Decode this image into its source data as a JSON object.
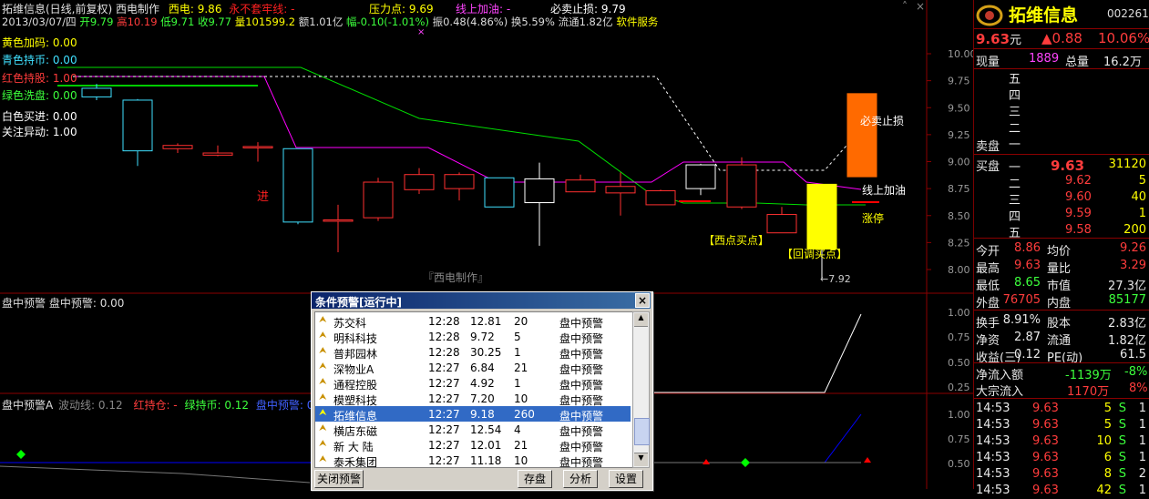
{
  "header": {
    "stock_title": "拓维信息(日线,前复权)",
    "indicator": "西电制作",
    "xidian_label": "西电:",
    "xidian_value": "9.86",
    "never_cover_label": "永不套牢线:",
    "never_cover_value": "-",
    "pressure_label": "压力点:",
    "pressure_value": "9.69",
    "online_add_label": "线上加油:",
    "online_add_value": "-",
    "must_sell_label": "必卖止损:",
    "must_sell_value": "9.79",
    "date": "2013/03/07/四",
    "open": "开9.79",
    "high": "高10.19",
    "low": "低9.71",
    "close": "收9.77",
    "volume": "量101599.2",
    "amount": "额1.01亿",
    "change": "幅-0.10(-1.01%)",
    "amplitude": "振0.48(4.86%)",
    "turnover": "换5.59%",
    "float_cap": "流通1.82亿",
    "service": "软件服务"
  },
  "legend": {
    "yellow_add": "黄色加码: 0.00",
    "cyan_hold": "青色持币: 0.00",
    "red_hold": "红色持股: 1.00",
    "green_wash": "绿色洗盘: 0.00",
    "white_buy": "白色买进: 0.00",
    "focus": "关注异动: 1.00"
  },
  "main_chart": {
    "price_axis": [
      "10.00",
      "9.75",
      "9.50",
      "9.25",
      "9.00",
      "8.75",
      "8.50",
      "8.25",
      "8.00"
    ],
    "watermark": "『西电制作』",
    "jin": "进",
    "must_sell_tag": "必卖止损",
    "online_add_tag": "线上加油",
    "limit_up_tag": "涨停",
    "west_buy_tag": "【西点买点】",
    "pullback_buy_tag": "【回调买点】",
    "low_mark": "7.92",
    "candles": [
      {
        "o": 9.68,
        "c": 9.6,
        "h": 9.72,
        "l": 9.57
      },
      {
        "o": 9.57,
        "c": 9.1,
        "h": 9.58,
        "l": 8.96
      },
      {
        "o": 9.12,
        "c": 9.15,
        "h": 9.17,
        "l": 9.08
      },
      {
        "o": 9.06,
        "c": 9.08,
        "h": 9.15,
        "l": 9.05
      },
      {
        "o": 9.14,
        "c": 9.14,
        "h": 9.18,
        "l": 9.0
      },
      {
        "o": 9.12,
        "c": 8.44,
        "h": 9.12,
        "l": 8.42
      },
      {
        "o": 8.45,
        "c": 8.46,
        "h": 8.6,
        "l": 8.16
      },
      {
        "o": 8.48,
        "c": 8.81,
        "h": 8.85,
        "l": 8.45
      },
      {
        "o": 8.74,
        "c": 8.88,
        "h": 8.94,
        "l": 8.7
      },
      {
        "o": 8.75,
        "c": 8.88,
        "h": 8.9,
        "l": 8.64
      },
      {
        "o": 8.85,
        "c": 8.58,
        "h": 8.85,
        "l": 8.58
      },
      {
        "o": 8.84,
        "c": 8.62,
        "h": 8.99,
        "l": 8.22
      },
      {
        "o": 8.72,
        "c": 8.83,
        "h": 8.88,
        "l": 8.72
      },
      {
        "o": 8.71,
        "c": 8.77,
        "h": 8.9,
        "l": 8.5
      },
      {
        "o": 8.6,
        "c": 8.73,
        "h": 8.74,
        "l": 8.6
      },
      {
        "o": 8.97,
        "c": 8.75,
        "h": 8.98,
        "l": 8.69
      },
      {
        "o": 8.58,
        "c": 8.97,
        "h": 9.04,
        "l": 8.56
      },
      {
        "o": 8.34,
        "c": 8.51,
        "h": 8.58,
        "l": 8.34
      },
      {
        "o": 8.19,
        "c": 8.79,
        "h": 8.79,
        "l": 7.92
      },
      {
        "o": 8.86,
        "c": 9.63,
        "h": 9.63,
        "l": 8.86
      }
    ]
  },
  "sub1": {
    "title": "盘中预警",
    "value_label": "盘中预警: 0.00",
    "axis": [
      "1.00",
      "0.75",
      "0.50",
      "0.25"
    ]
  },
  "sub2": {
    "title": "盘中预警A",
    "wave": "波动线: 0.12",
    "red_hold": "红持仓: -",
    "green_hold": "绿持币: 0.12",
    "alert": "盘中预警: 0.0",
    "axis": [
      "1.00",
      "0.75",
      "0.50"
    ]
  },
  "dialog": {
    "title": "条件预警[运行中]",
    "close_icon": "×",
    "rows": [
      {
        "name": "苏交科",
        "time": "12:28",
        "price": "12.81",
        "count": "20",
        "type": "盘中预警"
      },
      {
        "name": "明科科技",
        "time": "12:28",
        "price": "9.72",
        "count": "5",
        "type": "盘中预警"
      },
      {
        "name": "普邦园林",
        "time": "12:28",
        "price": "30.25",
        "count": "1",
        "type": "盘中预警"
      },
      {
        "name": "深物业A",
        "time": "12:27",
        "price": "6.84",
        "count": "21",
        "type": "盘中预警"
      },
      {
        "name": "通程控股",
        "time": "12:27",
        "price": "4.92",
        "count": "1",
        "type": "盘中预警"
      },
      {
        "name": "模塑科技",
        "time": "12:27",
        "price": "7.20",
        "count": "10",
        "type": "盘中预警"
      },
      {
        "name": "拓维信息",
        "time": "12:27",
        "price": "9.18",
        "count": "260",
        "type": "盘中预警"
      },
      {
        "name": "横店东磁",
        "time": "12:27",
        "price": "12.54",
        "count": "4",
        "type": "盘中预警"
      },
      {
        "name": "新 大 陆",
        "time": "12:27",
        "price": "12.01",
        "count": "21",
        "type": "盘中预警"
      },
      {
        "name": "泰禾集团",
        "time": "12:27",
        "price": "11.18",
        "count": "10",
        "type": "盘中预警"
      }
    ],
    "btn_close": "关闭预警",
    "btn_save": "存盘",
    "btn_analyze": "分析",
    "btn_settings": "设置"
  },
  "quote": {
    "name": "拓维信息",
    "code": "002261",
    "price": "9.63",
    "price_unit": "元",
    "change": "▲0.88",
    "pct": "10.06%",
    "now_vol_label": "现量",
    "now_vol": "1889",
    "total_vol_label": "总量",
    "total_vol": "16.2万",
    "sell_label": "卖盘",
    "sell_levels": [
      "五",
      "四",
      "三",
      "二",
      "一"
    ],
    "buy_label": "买盘",
    "buy_levels": [
      {
        "lvl": "一",
        "price": "9.63",
        "vol": "31120"
      },
      {
        "lvl": "二",
        "price": "9.62",
        "vol": "5"
      },
      {
        "lvl": "三",
        "price": "9.60",
        "vol": "40"
      },
      {
        "lvl": "四",
        "price": "9.59",
        "vol": "1"
      },
      {
        "lvl": "五",
        "price": "9.58",
        "vol": "200"
      }
    ],
    "stats": [
      {
        "l1": "今开",
        "v1": "8.86",
        "l2": "均价",
        "v2": "9.26"
      },
      {
        "l1": "最高",
        "v1": "9.63",
        "l2": "量比",
        "v2": "3.29"
      },
      {
        "l1": "最低",
        "v1": "8.65",
        "l2": "市值",
        "v2": "27.3亿"
      },
      {
        "l1": "外盘",
        "v1": "76705",
        "l2": "内盘",
        "v2": "85177"
      }
    ],
    "stats2": [
      {
        "l1": "换手",
        "v1": "8.91%",
        "l2": "股本",
        "v2": "2.83亿"
      },
      {
        "l1": "净资",
        "v1": "2.87",
        "l2": "流通",
        "v2": "1.82亿"
      },
      {
        "l1": "收益(三)",
        "v1": "0.12",
        "l2": "PE(动)",
        "v2": "61.5"
      }
    ],
    "net_inflow_label": "净流入额",
    "net_inflow": "-1139万",
    "net_inflow_pct": "-8%",
    "block_label": "大宗流入",
    "block": "1170万",
    "block_pct": "8%",
    "ticks": [
      {
        "t": "14:53",
        "p": "9.63",
        "v": "5",
        "s": "S",
        "n": "1"
      },
      {
        "t": "14:53",
        "p": "9.63",
        "v": "5",
        "s": "S",
        "n": "1"
      },
      {
        "t": "14:53",
        "p": "9.63",
        "v": "10",
        "s": "S",
        "n": "1"
      },
      {
        "t": "14:53",
        "p": "9.63",
        "v": "6",
        "s": "S",
        "n": "1"
      },
      {
        "t": "14:53",
        "p": "9.63",
        "v": "8",
        "s": "S",
        "n": "2"
      },
      {
        "t": "14:53",
        "p": "9.63",
        "v": "42",
        "s": "S",
        "n": "1"
      }
    ]
  }
}
